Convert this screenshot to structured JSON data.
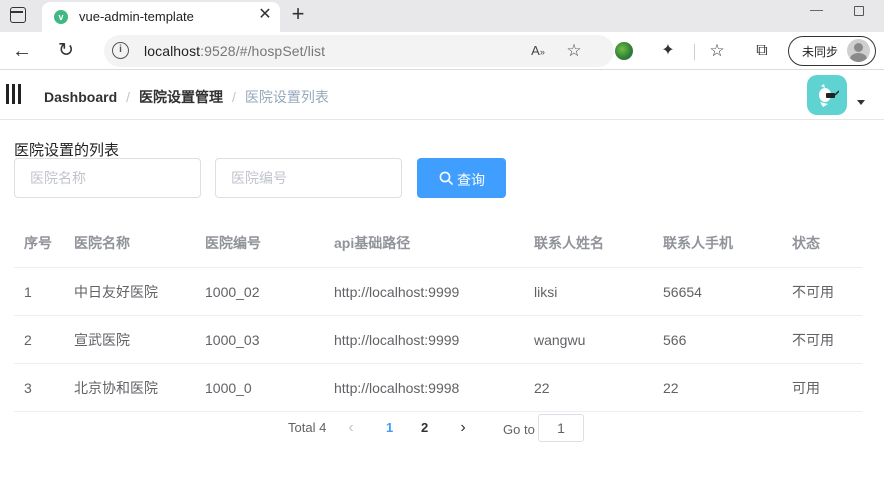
{
  "browser": {
    "tab_title": "vue-admin-template",
    "favicon_letter": "v",
    "url_host": "localhost",
    "url_path": ":9528/#/hospSet/list",
    "sync_label": "未同步"
  },
  "navbar": {
    "breadcrumb": [
      "Dashboard",
      "医院设置管理",
      "医院设置列表"
    ],
    "breadcrumb_separator": "/",
    "avatar_color": "#5ed3d1"
  },
  "page": {
    "title": "医院设置的列表"
  },
  "search": {
    "hosname_placeholder": "医院名称",
    "hoscode_placeholder": "医院编号",
    "button_label": "查询",
    "button_color": "#409eff"
  },
  "table": {
    "columns": [
      "序号",
      "医院名称",
      "医院编号",
      "api基础路径",
      "联系人姓名",
      "联系人手机",
      "状态"
    ],
    "rows": [
      [
        "1",
        "中日友好医院",
        "1000_02",
        "http://localhost:9999",
        "liksi",
        "56654",
        "不可用"
      ],
      [
        "2",
        "宣武医院",
        "1000_03",
        "http://localhost:9999",
        "wangwu",
        "566",
        "不可用"
      ],
      [
        "3",
        "北京协和医院",
        "1000_0",
        "http://localhost:9998",
        "22",
        "22",
        "可用"
      ]
    ]
  },
  "pagination": {
    "total_label": "Total 4",
    "pages": [
      "1",
      "2"
    ],
    "current_page": "1",
    "goto_label": "Go to",
    "goto_value": "1",
    "active_color": "#409eff"
  }
}
